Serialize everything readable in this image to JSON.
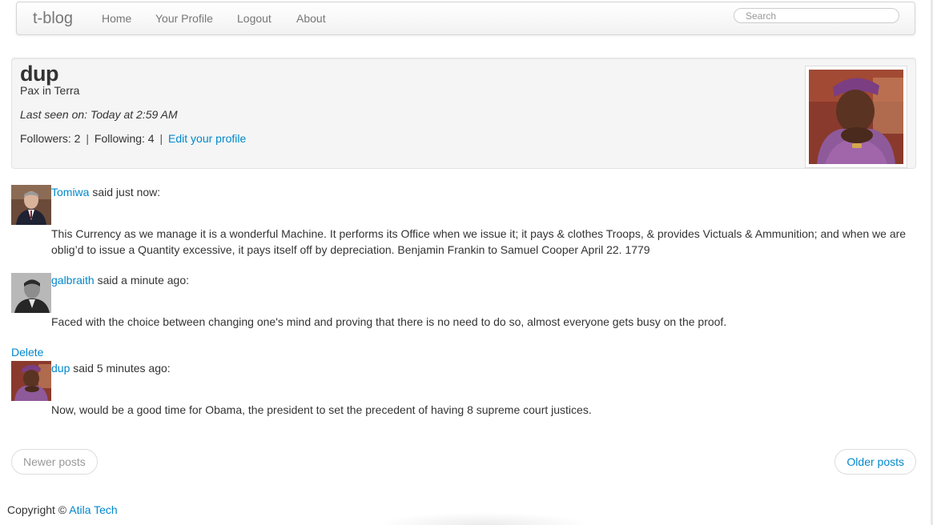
{
  "navbar": {
    "brand": "t-blog",
    "links": [
      "Home",
      "Your Profile",
      "Logout",
      "About"
    ],
    "search_placeholder": "Search"
  },
  "profile": {
    "username": "dup",
    "about": "Pax in Terra",
    "last_seen": "Last seen on: Today at 2:59 AM",
    "followers_text": "Followers: 2",
    "following_text": "Following: 4",
    "separator": "|",
    "edit_link": "Edit your profile"
  },
  "posts": [
    {
      "author": "Tomiwa",
      "said": " said just now:",
      "body": "This Currency as we manage it is a wonderful Machine. It performs its Office when we issue it; it pays & clothes Troops, & provides Victuals & Ammunition; and when we are oblig’d to issue a Quantity excessive, it pays itself off by depreciation. Benjamin Frankin to Samuel Cooper April 22. 1779"
    },
    {
      "author": "galbraith",
      "said": " said a minute ago:",
      "body": "Faced with the choice between changing one's mind and proving that there is no need to do so, almost everyone gets busy on the proof."
    },
    {
      "author": "dup",
      "said": " said 5 minutes ago:",
      "body": "Now, would be a good time for Obama, the president to set the precedent of having 8 supreme court justices."
    }
  ],
  "delete_label": "Delete",
  "pager": {
    "newer": "Newer posts",
    "older": "Older posts"
  },
  "footer": {
    "copyright": "Copyright ©",
    "company": "Atila Tech"
  },
  "colors": {
    "link": "#0088cc",
    "text": "#333333",
    "muted": "#777777"
  }
}
